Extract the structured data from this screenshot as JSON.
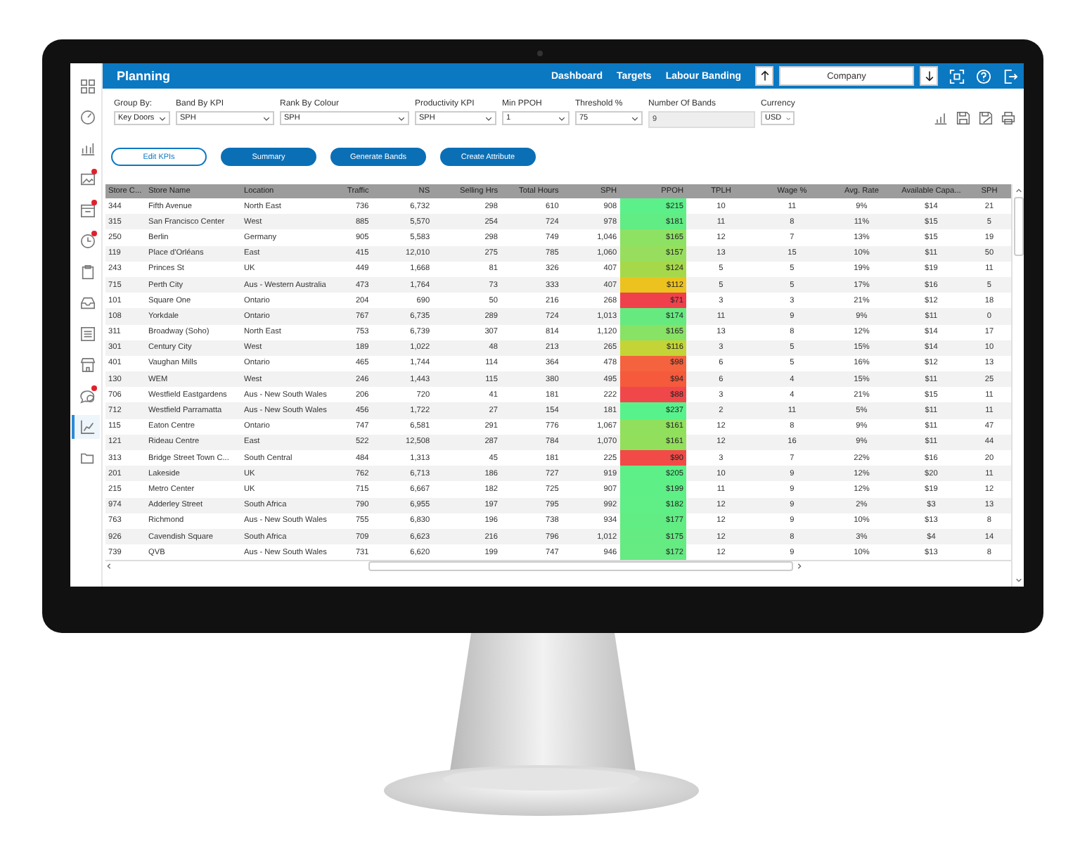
{
  "app": {
    "title": "Planning"
  },
  "sidebar": [
    {
      "kind": "grid",
      "badge": false,
      "selected": false
    },
    {
      "kind": "gauge",
      "badge": false,
      "selected": false
    },
    {
      "kind": "bars",
      "badge": false,
      "selected": false
    },
    {
      "kind": "picture",
      "badge": true,
      "selected": false
    },
    {
      "kind": "calendar",
      "badge": true,
      "selected": false
    },
    {
      "kind": "clock",
      "badge": true,
      "selected": false
    },
    {
      "kind": "clipboard",
      "badge": false,
      "selected": false
    },
    {
      "kind": "tray",
      "badge": false,
      "selected": false
    },
    {
      "kind": "list",
      "badge": false,
      "selected": false
    },
    {
      "kind": "store",
      "badge": false,
      "selected": false
    },
    {
      "kind": "chat",
      "badge": true,
      "selected": false
    },
    {
      "kind": "chart",
      "badge": false,
      "selected": true
    },
    {
      "kind": "folder",
      "badge": false,
      "selected": false
    }
  ],
  "nav": [
    {
      "label": "Dashboard"
    },
    {
      "label": "Targets"
    },
    {
      "label": "Labour Banding"
    }
  ],
  "company_field": {
    "value": "Company"
  },
  "filters": [
    {
      "label": "Group By:",
      "value": "Key Doors",
      "kind": "select"
    },
    {
      "label": "Band By KPI",
      "value": "SPH",
      "kind": "select"
    },
    {
      "label": "Rank By Colour",
      "value": "SPH",
      "kind": "select"
    },
    {
      "label": "Productivity KPI",
      "value": "SPH",
      "kind": "select"
    },
    {
      "label": "Min PPOH",
      "value": "1",
      "kind": "select"
    },
    {
      "label": "Threshold %",
      "value": "75",
      "kind": "select"
    },
    {
      "label": "Number Of Bands",
      "value": "9",
      "kind": "input",
      "disabled": true
    },
    {
      "label": "Currency",
      "value": "USD",
      "kind": "select"
    }
  ],
  "actions": [
    {
      "label": "Edit KPIs",
      "kind": "outline"
    },
    {
      "label": "Summary",
      "kind": "filled"
    },
    {
      "label": "Generate Bands",
      "kind": "filled"
    },
    {
      "label": "Create Attribute",
      "kind": "filled"
    }
  ],
  "table": {
    "columns": [
      "Store C...",
      "Store Name",
      "Location",
      "Traffic",
      "NS",
      "Selling Hrs",
      "Total Hours",
      "SPH",
      "PPOH",
      "TPLH",
      "Wage %",
      "Avg. Rate",
      "Available Capa...",
      "SPH"
    ],
    "rows": [
      {
        "cells": [
          "344",
          "Fifth Avenue",
          "North East",
          "736",
          "6,732",
          "298",
          "610",
          "908",
          "$215",
          "10",
          "11",
          "9%",
          "$14",
          "21"
        ],
        "color": "#5cf08a"
      },
      {
        "cells": [
          "315",
          "San Francisco Center",
          "West",
          "885",
          "5,570",
          "254",
          "724",
          "978",
          "$181",
          "11",
          "8",
          "11%",
          "$15",
          "5"
        ],
        "color": "#62ec84"
      },
      {
        "cells": [
          "250",
          "Berlin",
          "Germany",
          "905",
          "5,583",
          "298",
          "749",
          "1,046",
          "$165",
          "12",
          "7",
          "13%",
          "$15",
          "19"
        ],
        "color": "#8de264"
      },
      {
        "cells": [
          "119",
          "Place d'Orléans",
          "East",
          "415",
          "12,010",
          "275",
          "785",
          "1,060",
          "$157",
          "13",
          "15",
          "10%",
          "$11",
          "50"
        ],
        "color": "#98de5e"
      },
      {
        "cells": [
          "243",
          "Princes St",
          "UK",
          "449",
          "1,668",
          "81",
          "326",
          "407",
          "$124",
          "5",
          "5",
          "19%",
          "$19",
          "11"
        ],
        "color": "#a6d94a"
      },
      {
        "cells": [
          "715",
          "Perth City",
          "Aus - Western Australia",
          "473",
          "1,764",
          "73",
          "333",
          "407",
          "$112",
          "5",
          "5",
          "17%",
          "$16",
          "5"
        ],
        "color": "#ecc21e"
      },
      {
        "cells": [
          "101",
          "Square One",
          "Ontario",
          "204",
          "690",
          "50",
          "216",
          "268",
          "$71",
          "3",
          "3",
          "21%",
          "$12",
          "18"
        ],
        "color": "#f0404c"
      },
      {
        "cells": [
          "108",
          "Yorkdale",
          "Ontario",
          "767",
          "6,735",
          "289",
          "724",
          "1,013",
          "$174",
          "11",
          "9",
          "9%",
          "$11",
          "0"
        ],
        "color": "#66ea80"
      },
      {
        "cells": [
          "311",
          "Broadway (Soho)",
          "North East",
          "753",
          "6,739",
          "307",
          "814",
          "1,120",
          "$165",
          "13",
          "8",
          "12%",
          "$14",
          "17"
        ],
        "color": "#88e266"
      },
      {
        "cells": [
          "301",
          "Century City",
          "West",
          "189",
          "1,022",
          "48",
          "213",
          "265",
          "$116",
          "3",
          "5",
          "15%",
          "$14",
          "10"
        ],
        "color": "#c4d436"
      },
      {
        "cells": [
          "401",
          "Vaughan Mills",
          "Ontario",
          "465",
          "1,744",
          "114",
          "364",
          "478",
          "$98",
          "6",
          "5",
          "16%",
          "$12",
          "13"
        ],
        "color": "#f5623e"
      },
      {
        "cells": [
          "130",
          "WEM",
          "West",
          "246",
          "1,443",
          "115",
          "380",
          "495",
          "$94",
          "6",
          "4",
          "15%",
          "$11",
          "25"
        ],
        "color": "#f55a3c"
      },
      {
        "cells": [
          "706",
          "Westfield Eastgardens",
          "Aus - New South Wales",
          "206",
          "720",
          "41",
          "181",
          "222",
          "$88",
          "3",
          "4",
          "21%",
          "$15",
          "11"
        ],
        "color": "#f0484a"
      },
      {
        "cells": [
          "712",
          "Westfield Parramatta",
          "Aus - New South Wales",
          "456",
          "1,722",
          "27",
          "154",
          "181",
          "$237",
          "2",
          "11",
          "5%",
          "$11",
          "11"
        ],
        "color": "#58f28c"
      },
      {
        "cells": [
          "115",
          "Eaton Centre",
          "Ontario",
          "747",
          "6,581",
          "291",
          "776",
          "1,067",
          "$161",
          "12",
          "8",
          "9%",
          "$11",
          "47"
        ],
        "color": "#90e05e"
      },
      {
        "cells": [
          "121",
          "Rideau Centre",
          "East",
          "522",
          "12,508",
          "287",
          "784",
          "1,070",
          "$161",
          "12",
          "16",
          "9%",
          "$11",
          "44"
        ],
        "color": "#92df5c"
      },
      {
        "cells": [
          "313",
          "Bridge Street Town C...",
          "South Central",
          "484",
          "1,313",
          "45",
          "181",
          "225",
          "$90",
          "3",
          "7",
          "22%",
          "$16",
          "20"
        ],
        "color": "#f24a46"
      },
      {
        "cells": [
          "201",
          "Lakeside",
          "UK",
          "762",
          "6,713",
          "186",
          "727",
          "919",
          "$205",
          "10",
          "9",
          "12%",
          "$20",
          "11"
        ],
        "color": "#5ef088"
      },
      {
        "cells": [
          "215",
          "Metro Center",
          "UK",
          "715",
          "6,667",
          "182",
          "725",
          "907",
          "$199",
          "11",
          "9",
          "12%",
          "$19",
          "12"
        ],
        "color": "#5fef87"
      },
      {
        "cells": [
          "974",
          "Adderley Street",
          "South Africa",
          "790",
          "6,955",
          "197",
          "795",
          "992",
          "$182",
          "12",
          "9",
          "2%",
          "$3",
          "13"
        ],
        "color": "#60ee86"
      },
      {
        "cells": [
          "763",
          "Richmond",
          "Aus - New South Wales",
          "755",
          "6,830",
          "196",
          "738",
          "934",
          "$177",
          "12",
          "9",
          "10%",
          "$13",
          "8"
        ],
        "color": "#62ec84"
      },
      {
        "cells": [
          "926",
          "Cavendish Square",
          "South Africa",
          "709",
          "6,623",
          "216",
          "796",
          "1,012",
          "$175",
          "12",
          "8",
          "3%",
          "$4",
          "14"
        ],
        "color": "#64ec82"
      },
      {
        "cells": [
          "739",
          "QVB",
          "Aus - New South Wales",
          "731",
          "6,620",
          "199",
          "747",
          "946",
          "$172",
          "12",
          "9",
          "10%",
          "$13",
          "8"
        ],
        "color": "#66ea82"
      }
    ]
  }
}
